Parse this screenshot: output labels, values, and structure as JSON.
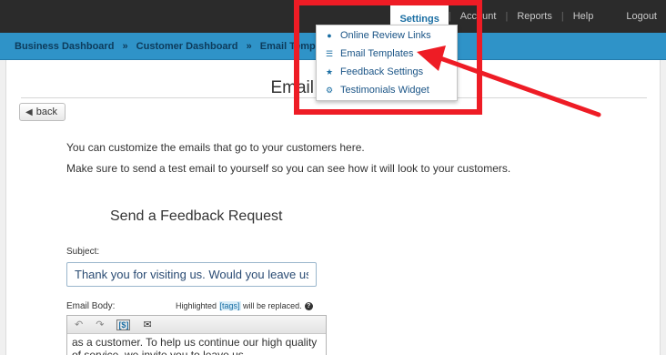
{
  "topnav": {
    "settings": "Settings",
    "account": "Account",
    "reports": "Reports",
    "help": "Help",
    "logout": "Logout"
  },
  "breadcrumb": [
    "Business Dashboard",
    "Customer Dashboard",
    "Email Templates"
  ],
  "breadcrumb_sep": "»",
  "page": {
    "title": "Email Templates",
    "back_label": "back",
    "intro_1": "You can customize the emails that go to your customers here.",
    "intro_2": "Make sure to send a test email to yourself so you can see how it will look to your customers.",
    "section_heading": "Send a Feedback Request",
    "subject_label": "Subject:",
    "subject_value": "Thank you for visiting us. Would you leave us a review?",
    "body_label": "Email Body:",
    "highlight_note_pre": "Highlighted ",
    "highlight_note_tag": "[tags]",
    "highlight_note_post": " will be replaced.",
    "body_text": "as a customer. To help us continue our high quality of service, we invite you to leave us"
  },
  "dropdown": {
    "items": [
      {
        "label": "Online Review Links",
        "icon": "globe-icon"
      },
      {
        "label": "Email Templates",
        "icon": "list-icon"
      },
      {
        "label": "Feedback Settings",
        "icon": "star-icon"
      },
      {
        "label": "Testimonials Widget",
        "icon": "gear-icon"
      }
    ]
  },
  "colors": {
    "topbar": "#2b2b2b",
    "crumbbar": "#2f93c8",
    "link": "#1a6ea3",
    "highlight_red": "#ee1c25"
  }
}
